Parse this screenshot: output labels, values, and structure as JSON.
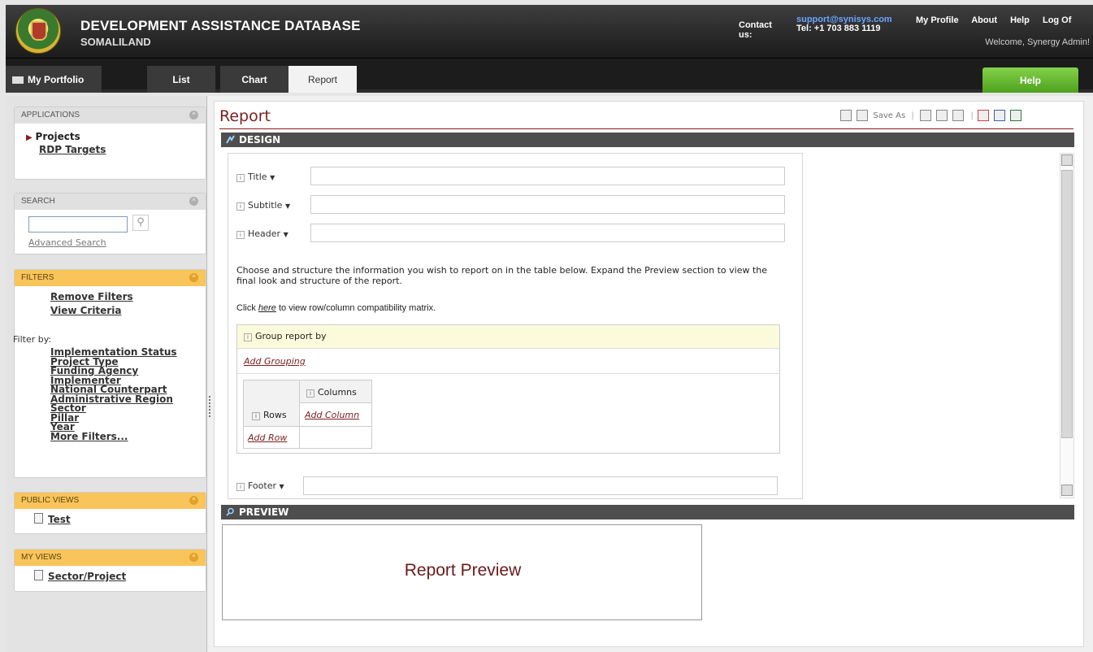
{
  "header": {
    "title": "DEVELOPMENT ASSISTANCE DATABASE",
    "subtitle": "SOMALILAND",
    "contact_label": "Contact us:",
    "contact_email": "support@synisys.com",
    "contact_tel": "Tel: +1 703 883 1119",
    "nav": [
      "My Profile",
      "About",
      "Help",
      "Log Of"
    ],
    "welcome": "Welcome, Synergy Admin!"
  },
  "tabs": {
    "portfolio": "My Portfolio",
    "list": "List",
    "chart": "Chart",
    "report": "Report",
    "help": "Help"
  },
  "sidebar": {
    "applications": {
      "heading": "APPLICATIONS",
      "items": [
        "Projects",
        "RDP Targets"
      ]
    },
    "search": {
      "heading": "SEARCH",
      "input_value": "",
      "advanced": "Advanced Search"
    },
    "filters": {
      "heading": "FILTERS",
      "remove": "Remove Filters",
      "view": "View Criteria",
      "filter_by": "Filter by:",
      "items": [
        "Implementation Status",
        "Project Type",
        "Funding Agency",
        "Implementer",
        "National Counterpart",
        "Administrative Region",
        "Sector",
        "Pillar",
        "Year",
        "More Filters..."
      ]
    },
    "public_views": {
      "heading": "PUBLIC VIEWS",
      "items": [
        "Test"
      ]
    },
    "my_views": {
      "heading": "MY VIEWS",
      "items": [
        "Sector/Project"
      ]
    }
  },
  "report": {
    "title": "Report",
    "save_as": "Save As",
    "design_heading": "DESIGN",
    "preview_heading": "PREVIEW",
    "fields": {
      "title_label": "Title",
      "subtitle_label": "Subtitle",
      "header_label": "Header",
      "footer_label": "Footer",
      "title_value": "",
      "subtitle_value": "",
      "header_value": "",
      "footer_value": ""
    },
    "instructions": "Choose and structure the information you wish to report on in the table below. Expand the Preview section to view the final look and structure of the report.",
    "matrix_prefix": "Click",
    "matrix_link": "here",
    "matrix_suffix": "to view row/column compatibility matrix.",
    "group_label": "Group report by",
    "add_grouping": "Add Grouping",
    "columns_label": "Columns",
    "rows_label": "Rows",
    "add_column": "Add Column",
    "add_row": "Add Row",
    "preview_text": "Report Preview"
  },
  "colors": {
    "accent_red": "#7a1f1f",
    "help_green": "#5cb52a",
    "filter_orange": "#f9c45a"
  }
}
